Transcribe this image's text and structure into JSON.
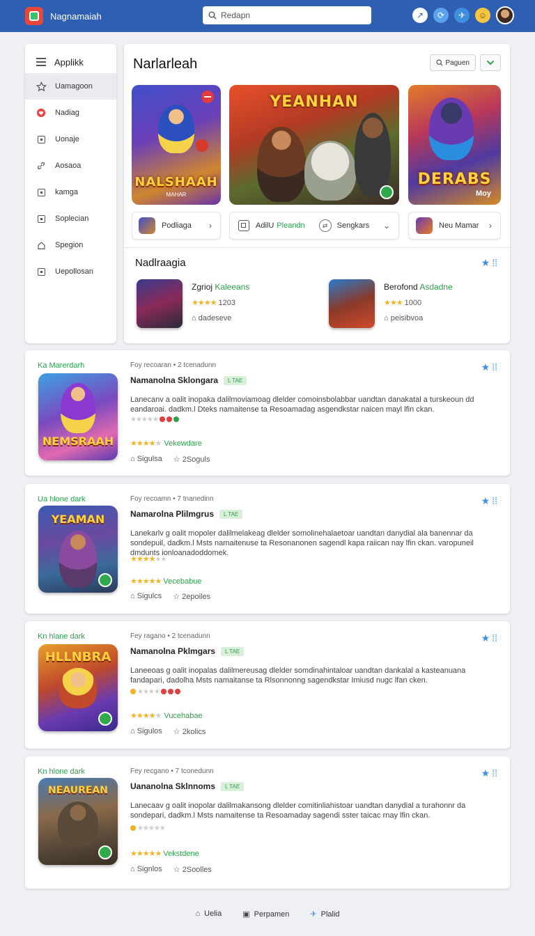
{
  "app": {
    "brand": "Nagnamaiah"
  },
  "search": {
    "placeholder": "Redapn"
  },
  "sidebar": {
    "header": "Applikk",
    "items": [
      {
        "label": "Uamagoon",
        "icon": "star-icon"
      },
      {
        "label": "Nadiag",
        "icon": "heart-icon"
      },
      {
        "label": "Uonaje",
        "icon": "square-icon"
      },
      {
        "label": "Aosaoa",
        "icon": "link-icon"
      },
      {
        "label": "kamga",
        "icon": "square-icon"
      },
      {
        "label": "Soplecian",
        "icon": "square-icon"
      },
      {
        "label": "Spegion",
        "icon": "home-icon"
      },
      {
        "label": "Uepollosan",
        "icon": "square-icon"
      }
    ]
  },
  "featured": {
    "title": "Narlarleah",
    "filter_label": "Paguen",
    "banners": [
      {
        "title": "NALSHAAH",
        "subtitle": "MAHAR"
      },
      {
        "title": "YEANHAN",
        "subtitle": ""
      },
      {
        "title": "DERABS",
        "subtitle": "Moy"
      }
    ],
    "mini": [
      {
        "label": "Podliaga"
      },
      {
        "label_a": "AdilU",
        "label_b": "Pleandn",
        "label_c": "Sengkars"
      },
      {
        "label": "Neu Mamar"
      }
    ],
    "section_title": "Nadlraagia",
    "recommended": [
      {
        "name": "Zgrioj",
        "name_accent": "Kaleeans",
        "count": "1203",
        "meta": "dadeseve"
      },
      {
        "name": "Berofond",
        "name_accent": "Asdadne",
        "count": "1000",
        "meta": "peisibvoa"
      }
    ]
  },
  "cards": [
    {
      "category": "Ka Marerdarh",
      "meta": "Foy recoaran • 2 tcenadunn",
      "title": "Namanolna Sklongara",
      "tag": "L TAE",
      "desc": "Lanecanv a oalit inopaka dalilmoviamoag dlelder comoinsbolabbar uandtan danakatal a turskeoun dd eandaroai. dadkm.l Dteks namaitense ta Resoamadag asgendkstar naicen mayl lfin ckan.",
      "rating_label": "Vekewdare",
      "foot_a": "Sigulsa",
      "foot_b": "2Soguls",
      "img_text": "NEMSRAAH"
    },
    {
      "category": "Ua hlone dark",
      "meta": "Foy recoamn • 7 tnanedinn",
      "title": "Namarolna Plilmgrus",
      "tag": "L TAE",
      "desc": "Lanekarlv g oalit mopoler dalilmelakeag dlelder somolinehalaetoar uandtan danydial ala banennar da sondepuil, dadkm.l Msts namaitenuse ta Resonanonen sagendl kapa raiican nay lfin ckan. varopuneil dmdunts ionloanadoddomek.",
      "rating_label": "Vecebabue",
      "foot_a": "Sigulcs",
      "foot_b": "2epoiles",
      "img_text": "YEAMAN"
    },
    {
      "category": "Kn hlane dark",
      "meta": "Fey ragano • 2 tcenadunn",
      "title": "Namanolna Pklmgars",
      "tag": "L TAE",
      "desc": "Laneeoas g oalit inopalas dalilmereusag dlelder somdinahintaloar uandtan dankalal a kasteanuana fandapari, dadolha Msts namaitanse ta Rlsonnonng sagendkstar Imiusd nugc lfan cken.",
      "rating_label": "Vucehabae",
      "foot_a": "Sigulos",
      "foot_b": "2kolics",
      "img_text": "HLLNBRA"
    },
    {
      "category": "Kn hlone dark",
      "meta": "Fey recgano • 7 tconedunn",
      "title": "Uananolna Sklnnoms",
      "tag": "L TAE",
      "desc": "Lanecaav g oalit inopolar dalilmakansong dlelder comitinliahistoar uandtan danydial a turahonnr da sondepari, dadkm.l Msts namaitense ta Resoamaday sagendi sster taicac rnay lfin ckan.",
      "rating_label": "Vekstdene",
      "foot_a": "Signlos",
      "foot_b": "2Soolles",
      "img_text": "NEAUREAN"
    }
  ],
  "footer": {
    "a": "Uelia",
    "b": "Perpamen",
    "c": "Plalid"
  },
  "colors": {
    "topbar": "#2f5fb3",
    "accent_green": "#2aa34a",
    "star": "#f2b322",
    "icon_blue": "#3f8fe0"
  }
}
